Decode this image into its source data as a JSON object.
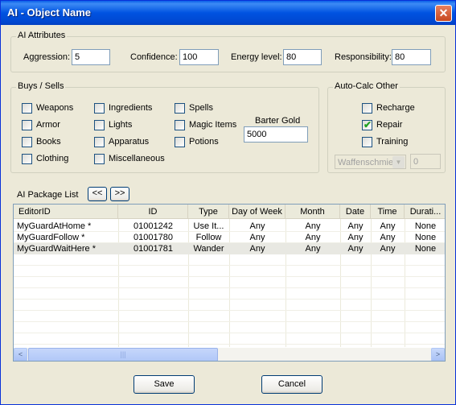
{
  "window": {
    "title": "AI - Object Name",
    "close_glyph": "✕"
  },
  "ai_attributes": {
    "title": "AI Attributes",
    "aggression": {
      "label": "Aggression:",
      "value": "5"
    },
    "confidence": {
      "label": "Confidence:",
      "value": "100"
    },
    "energy": {
      "label": "Energy level:",
      "value": "80"
    },
    "responsibility": {
      "label": "Responsibility:",
      "value": "80"
    }
  },
  "buys_sells": {
    "title": "Buys / Sells",
    "items": [
      {
        "label": "Weapons",
        "checked": false
      },
      {
        "label": "Armor",
        "checked": false
      },
      {
        "label": "Books",
        "checked": false
      },
      {
        "label": "Clothing",
        "checked": false
      },
      {
        "label": "Ingredients",
        "checked": false
      },
      {
        "label": "Lights",
        "checked": false
      },
      {
        "label": "Apparatus",
        "checked": false
      },
      {
        "label": "Miscellaneous",
        "checked": false
      },
      {
        "label": "Spells",
        "checked": false
      },
      {
        "label": "Magic Items",
        "checked": false
      },
      {
        "label": "Potions",
        "checked": false
      }
    ],
    "barter_gold": {
      "label": "Barter Gold",
      "value": "5000"
    }
  },
  "auto_calc": {
    "title": "Auto-Calc Other",
    "recharge": {
      "label": "Recharge",
      "checked": false
    },
    "repair": {
      "label": "Repair",
      "checked": true
    },
    "training": {
      "label": "Training",
      "checked": false
    },
    "skill_select": "Waffenschmie",
    "skill_value": "0"
  },
  "packages": {
    "label": "AI Package List",
    "prev_label": "<<",
    "next_label": ">>",
    "columns": [
      "EditorID",
      "ID",
      "Type",
      "Day of Week",
      "Month",
      "Date",
      "Time",
      "Durati..."
    ],
    "rows": [
      {
        "editor_id": "MyGuardAtHome *",
        "id": "01001242",
        "type": "Use It...",
        "day": "Any",
        "month": "Any",
        "date": "Any",
        "time": "Any",
        "duration": "None",
        "selected": false
      },
      {
        "editor_id": "MyGuardFollow *",
        "id": "01001780",
        "type": "Follow",
        "day": "Any",
        "month": "Any",
        "date": "Any",
        "time": "Any",
        "duration": "None",
        "selected": false
      },
      {
        "editor_id": "MyGuardWaitHere *",
        "id": "01001781",
        "type": "Wander",
        "day": "Any",
        "month": "Any",
        "date": "Any",
        "time": "Any",
        "duration": "None",
        "selected": true
      }
    ],
    "scroll_left": "<",
    "scroll_right": ">",
    "scroll_grip": "|||"
  },
  "footer": {
    "save_label": "Save",
    "cancel_label": "Cancel"
  }
}
